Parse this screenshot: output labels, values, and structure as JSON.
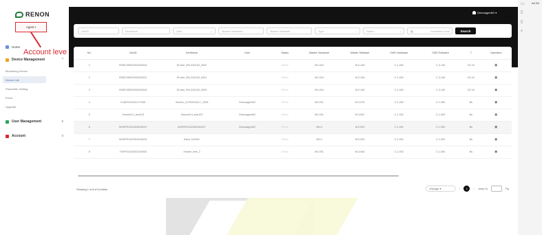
{
  "header": {
    "username": "Demoagent01 ▾"
  },
  "sidebar": {
    "logo": "RENON",
    "agent_label": "Agent I",
    "annotation": "Account leve",
    "home": "Home",
    "device_management": "Device Management",
    "device_items": [
      "Monitoring Device",
      "Device List",
      "Parameter Setting",
      "Event",
      "Upgrade"
    ],
    "user_management": "User Management",
    "account": "Account"
  },
  "filters": {
    "fields": [
      "DevID",
      "DevName",
      "User",
      "Master Hardware",
      "Master Software",
      "Type",
      "Status"
    ],
    "date_placeholder": "Installation time",
    "search_label": "Search"
  },
  "table": {
    "columns": [
      "No.",
      "DevID",
      "DevName",
      "User",
      "Status",
      "Master Hardware",
      "Master Software",
      "CMS Hardware",
      "CMS Software",
      "T",
      "Operation"
    ],
    "rows": [
      [
        "1",
        "RNEC05902903240000",
        "ECube_RN-240130_0002",
        "",
        "Offline",
        "M1.004",
        "M.2.106",
        "C.1.002",
        "C.2.140",
        "DC M",
        "◉"
      ],
      [
        "2",
        "RNEC05902903240001",
        "ECube_RN-240130_0001",
        "",
        "Offline",
        "M1.004",
        "M.2.106",
        "C.1.002",
        "C.2.140",
        "DC M",
        "◉"
      ],
      [
        "3",
        "RNEC05902903240002",
        "ECube_RN-240130_0003",
        "",
        "Offline",
        "M1.004",
        "M.2.106",
        "C.1.002",
        "C.2.140",
        "DC M",
        "◉"
      ],
      [
        "4",
        "E1822202311171005",
        "Xhome_LV-RN231117_1005",
        "Demoagent02",
        "Offline",
        "M1.001",
        "M.3.076",
        "C.1.002",
        "C.1.000",
        "Bs",
        "◉"
      ],
      [
        "5",
        "Xhome5.0_test123",
        "Xhome5.0_test123",
        "Demoagent02",
        "Offline",
        "M1.001",
        "M.3.087",
        "C.1.002",
        "C.1.000",
        "Bs",
        "◉"
      ],
      [
        "6",
        "MXRP01202305130007",
        "MXRP01202305130007",
        "Demoagent02",
        "Offline",
        "M0.0",
        "M.0.000",
        "C.1.001",
        "C.1.000",
        "Bs",
        "◉"
      ],
      [
        "7",
        "MXRP01202303140001",
        "Escol 140001",
        "",
        "Offline",
        "M0.0",
        "M.0.000",
        "C.1.001",
        "C.1.000",
        "Bs",
        "◉"
      ],
      [
        "8",
        "TXRP01202302100003",
        "Xhome_test_2",
        "",
        "Offline",
        "M1.001",
        "M.3.064",
        "C.1.002",
        "C.1.000",
        "Bs",
        "◉"
      ]
    ]
  },
  "pagination": {
    "showing": "Showing 1 to 8 of 8 entries",
    "page_size": "10/page ▾",
    "prev": "‹",
    "current": "1",
    "next": "›",
    "goto_label": "Jump to",
    "goto_suffix": "Pg"
  },
  "right_strip": {
    "label": "Ad Wi"
  },
  "colors": {
    "brand_green": "#1f7a3a",
    "annotation_red": "#d9282f",
    "header_black": "#111111"
  }
}
